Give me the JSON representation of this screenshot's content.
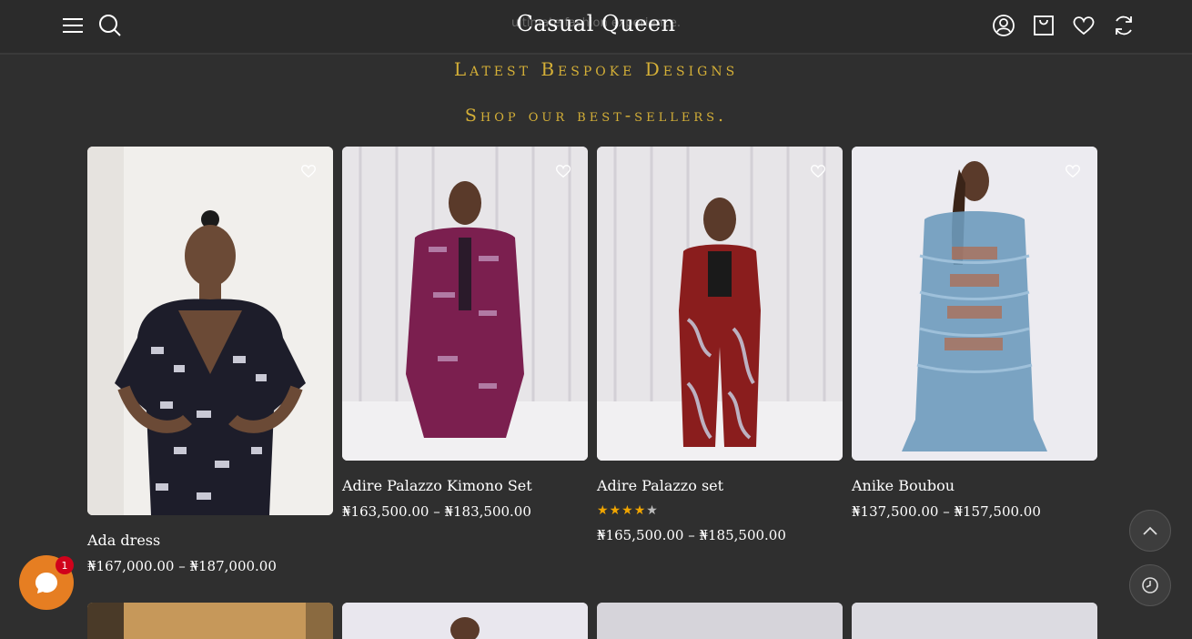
{
  "header": {
    "brand": "Casual Queen",
    "ghost_text": "ultimate fashion experience.",
    "icons": [
      "menu-icon",
      "search-icon",
      "account-icon",
      "cart-icon",
      "wishlist-icon",
      "compare-icon"
    ]
  },
  "sections": {
    "title": "Latest Bespoke Designs",
    "subtitle": "Shop our best-sellers."
  },
  "products": [
    {
      "name": "Ada dress",
      "price": "₦167,000.00 – ₦187,000.00",
      "rating": null
    },
    {
      "name": "Adire Palazzo Kimono Set",
      "price": "₦163,500.00 – ₦183,500.00",
      "rating": null
    },
    {
      "name": "Adire Palazzo set",
      "price": "₦165,500.00 – ₦185,500.00",
      "rating": 4
    },
    {
      "name": "Anike Boubou",
      "price": "₦137,500.00 – ₦157,500.00",
      "rating": null
    }
  ],
  "chat": {
    "badge_count": "1"
  },
  "colors": {
    "accent": "#d4af37",
    "background": "#2f2f2f",
    "chat": "#e67e22"
  }
}
